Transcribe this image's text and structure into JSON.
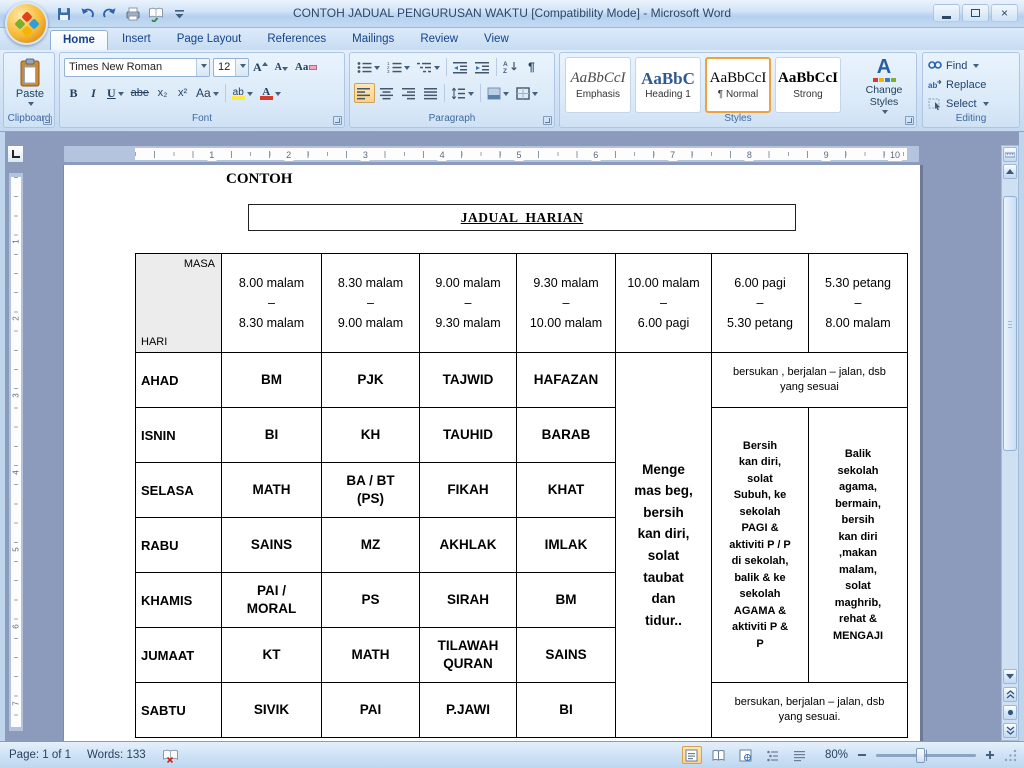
{
  "window": {
    "title": "CONTOH JADUAL PENGURUSAN WAKTU [Compatibility Mode] - Microsoft Word"
  },
  "icons": {
    "close": "×",
    "pilcrow": "¶"
  },
  "tabs": [
    {
      "label": "Home",
      "active": true
    },
    {
      "label": "Insert"
    },
    {
      "label": "Page Layout"
    },
    {
      "label": "References"
    },
    {
      "label": "Mailings"
    },
    {
      "label": "Review"
    },
    {
      "label": "View"
    }
  ],
  "ribbon": {
    "clipboard": {
      "label": "Clipboard",
      "paste": "Paste"
    },
    "font": {
      "label": "Font",
      "family": "Times New Roman",
      "size": "12",
      "bold": "B",
      "italic": "I",
      "underline": "U",
      "strike": "abe",
      "subscript": "x₂",
      "superscript": "x²",
      "change_case": "Aa",
      "highlight": "ab",
      "font_color": "A",
      "grow": "A",
      "shrink": "A",
      "clear": "Aa"
    },
    "paragraph": {
      "label": "Paragraph"
    },
    "styles": {
      "label": "Styles",
      "change_styles": "Change Styles",
      "gallery": [
        {
          "preview": "AaBbCcI",
          "name": "Emphasis"
        },
        {
          "preview": "AaBbC",
          "name": "Heading 1"
        },
        {
          "preview": "AaBbCcI",
          "name": "¶ Normal",
          "selected": true
        },
        {
          "preview": "AaBbCcI",
          "name": "Strong"
        }
      ]
    },
    "editing": {
      "label": "Editing",
      "find": "Find",
      "replace": "Replace",
      "select": "Select"
    }
  },
  "ruler": {
    "numbers": [
      "1",
      "2",
      "3",
      "4",
      "5",
      "6",
      "7",
      "8",
      "9",
      "10"
    ],
    "v_numbers": [
      "1",
      "2",
      "3",
      "4",
      "5",
      "6",
      "7"
    ]
  },
  "document": {
    "heading": "CONTOH",
    "boxed_title": "JADUAL  HARIAN",
    "table": {
      "corner_top": "MASA",
      "corner_bottom": "HARI",
      "time_headers": [
        "8.00 malam\n–\n8.30 malam",
        "8.30 malam\n–\n9.00 malam",
        "9.00 malam\n–\n9.30 malam",
        "9.30 malam\n–\n10.00 malam",
        "10.00 malam\n–\n6.00 pagi",
        "6.00 pagi\n–\n5.30 petang",
        "5.30 petang\n–\n8.00 malam"
      ],
      "rows": [
        {
          "day": "AHAD",
          "subjects": [
            "BM",
            "PJK",
            "TAJWID",
            "HAFAZAN"
          ]
        },
        {
          "day": "ISNIN",
          "subjects": [
            "BI",
            "KH",
            "TAUHID",
            "BARAB"
          ]
        },
        {
          "day": "SELASA",
          "subjects": [
            "MATH",
            "BA / BT\n(PS)",
            "FIKAH",
            "KHAT"
          ]
        },
        {
          "day": "RABU",
          "subjects": [
            "SAINS",
            "MZ",
            "AKHLAK",
            "IMLAK"
          ]
        },
        {
          "day": "KHAMIS",
          "subjects": [
            "PAI /\nMORAL",
            "PS",
            "SIRAH",
            "BM"
          ]
        },
        {
          "day": "JUMAAT",
          "subjects": [
            "KT",
            "MATH",
            "TILAWAH\nQURAN",
            "SAINS"
          ]
        },
        {
          "day": "SABTU",
          "subjects": [
            "SIVIK",
            "PAI",
            "P.JAWI",
            "BI"
          ]
        }
      ],
      "night_cell": "Menge\nmas beg,\nbersih\nkan diri,\nsolat\ntaubat\ndan\ntidur..",
      "ahad_weekend_cell": "bersukan , berjalan – jalan, dsb\nyang sesuai",
      "day_cell": "Bersih\nkan diri,\nsolat\nSubuh, ke\nsekolah\nPAGI &\naktiviti P / P\ndi sekolah,\nbalik & ke\nsekolah\nAGAMA &\naktiviti P &\nP",
      "evening_cell": "Balik\nsekolah\nagama,\nbermain,\nbersih\nkan diri\n,makan\nmalam,\nsolat\nmaghrib,\nrehat &\nMENGAJI",
      "sabtu_weekend_cell": "bersukan, berjalan – jalan, dsb\nyang sesuai."
    }
  },
  "status": {
    "page": "Page: 1 of 1",
    "words": "Words: 133",
    "zoom": "80%"
  }
}
